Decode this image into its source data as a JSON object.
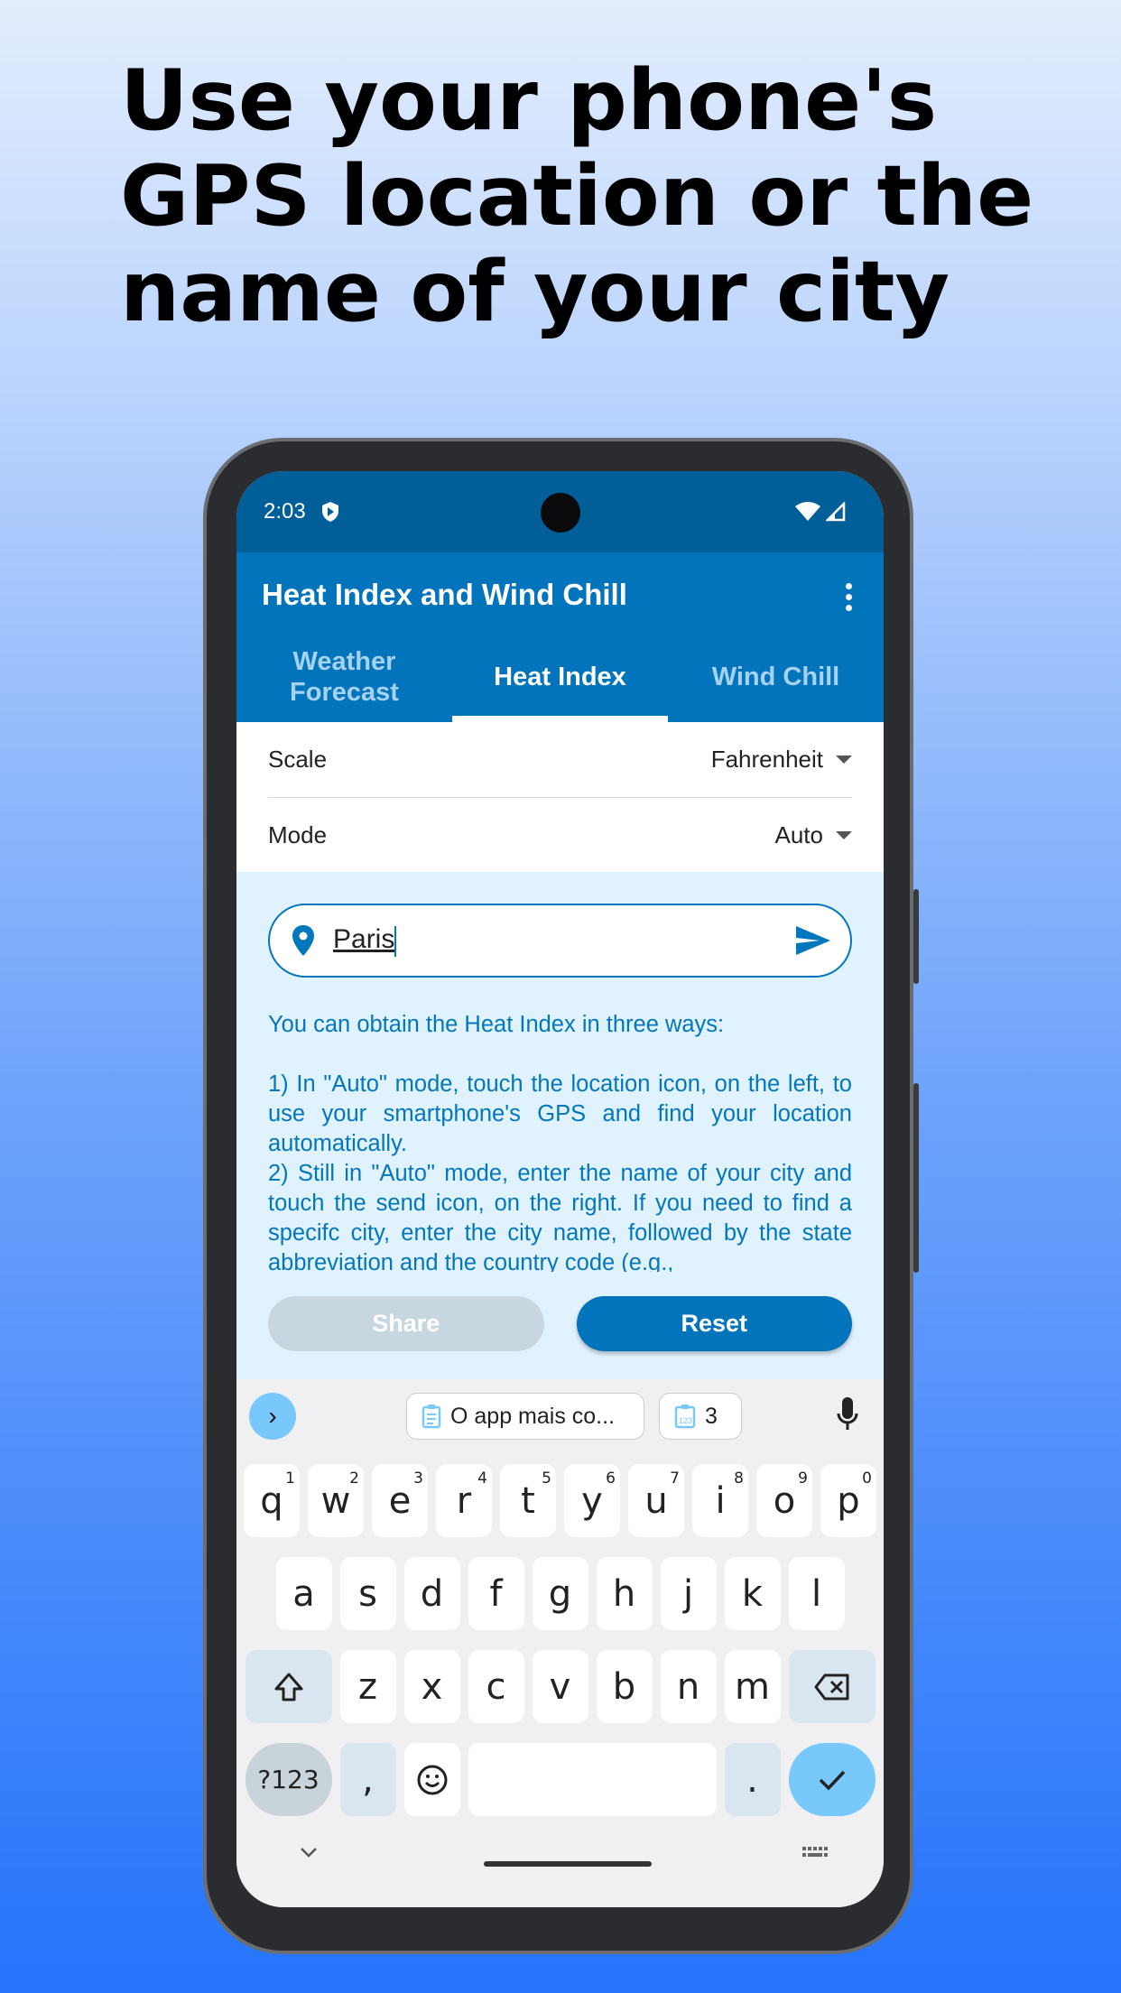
{
  "headline": [
    "Use your phone's",
    "GPS location or the",
    "name of your city"
  ],
  "status": {
    "time": "2:03",
    "icons": [
      "shield-play-icon",
      "wifi-icon",
      "signal-icon"
    ]
  },
  "app": {
    "title": "Heat Index and Wind Chill",
    "menu_icon": "more-vert-icon"
  },
  "tabs": [
    {
      "label": "Weather Forecast",
      "active": false
    },
    {
      "label": "Heat Index",
      "active": true
    },
    {
      "label": "Wind Chill",
      "active": false
    }
  ],
  "settings": {
    "scale_label": "Scale",
    "scale_value": "Fahrenheit",
    "mode_label": "Mode",
    "mode_value": "Auto"
  },
  "search": {
    "value": "Paris",
    "left_icon": "location-pin-icon",
    "right_icon": "send-icon"
  },
  "help": {
    "intro": "You can obtain the Heat Index in three ways:",
    "p1": "1) In \"Auto\" mode, touch the location icon, on the left, to use your smartphone's GPS and find your location automatically.",
    "p2": "2) Still in \"Auto\" mode, enter the name of your city and touch the send icon, on the right. If you need to find a specifc city, enter the city name, followed by the state abbreviation and the country code (e.g.,"
  },
  "buttons": {
    "share": "Share",
    "reset": "Reset"
  },
  "keyboard": {
    "suggestions": {
      "clip1": "O app mais co...",
      "clip2": "3"
    },
    "row1": [
      [
        "q",
        "1"
      ],
      [
        "w",
        "2"
      ],
      [
        "e",
        "3"
      ],
      [
        "r",
        "4"
      ],
      [
        "t",
        "5"
      ],
      [
        "y",
        "6"
      ],
      [
        "u",
        "7"
      ],
      [
        "i",
        "8"
      ],
      [
        "o",
        "9"
      ],
      [
        "p",
        "0"
      ]
    ],
    "row2": [
      "a",
      "s",
      "d",
      "f",
      "g",
      "h",
      "j",
      "k",
      "l"
    ],
    "row3": [
      "z",
      "x",
      "c",
      "v",
      "b",
      "n",
      "m"
    ],
    "symbols": "?123",
    "comma": ",",
    "period": "."
  },
  "colors": {
    "primary": "#0274bb",
    "status_bar": "#005e98",
    "panel": "#e0f2fd",
    "accent": "#79c8fc"
  }
}
